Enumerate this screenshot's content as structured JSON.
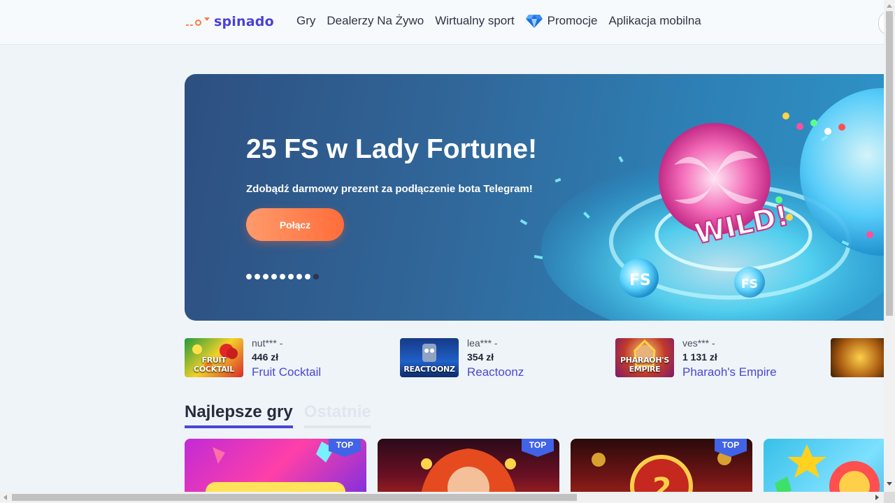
{
  "header": {
    "logo_text": "spinado",
    "nav": [
      {
        "label": "Gry"
      },
      {
        "label": "Dealerzy Na Żywo"
      },
      {
        "label": "Wirtualny sport"
      },
      {
        "label": "Promocje",
        "icon": "diamond-icon"
      },
      {
        "label": "Aplikacja mobilna"
      }
    ]
  },
  "banner": {
    "title": "25 FS w Lady Fortune!",
    "subtitle": "Zdobądź darmowy prezent za podłączenie bota Telegram!",
    "button_label": "Połącz",
    "slides_count": 9,
    "active_slide": 9,
    "art_text_wild": "WILD!",
    "art_text_fs_1": "FS",
    "art_text_fs_2": "FS"
  },
  "winners": [
    {
      "user": "nut*** -",
      "amount": "446 zł",
      "game": "Fruit Cocktail",
      "thumb_text": "FRUIT COCKTAIL"
    },
    {
      "user": "lea*** -",
      "amount": "354 zł",
      "game": "Reactoonz",
      "thumb_text": "REACTOONZ"
    },
    {
      "user": "ves*** -",
      "amount": "1 131 zł",
      "game": "Pharaoh's Empire",
      "thumb_text": "PHARAOH'S EMPIRE"
    },
    {
      "user": "",
      "amount": "",
      "game": "",
      "thumb_text": ""
    }
  ],
  "tabs": [
    {
      "label": "Najlepsze gry",
      "active": true
    },
    {
      "label": "Ostatnie",
      "active": false
    }
  ],
  "games": [
    {
      "badge": "TOP"
    },
    {
      "badge": "TOP"
    },
    {
      "badge": "TOP"
    },
    {
      "badge": ""
    }
  ],
  "colors": {
    "brand": "#4b3fd8",
    "accent_button": "#ff7a45",
    "link": "#4b46d6",
    "badge": "#4163e8"
  }
}
